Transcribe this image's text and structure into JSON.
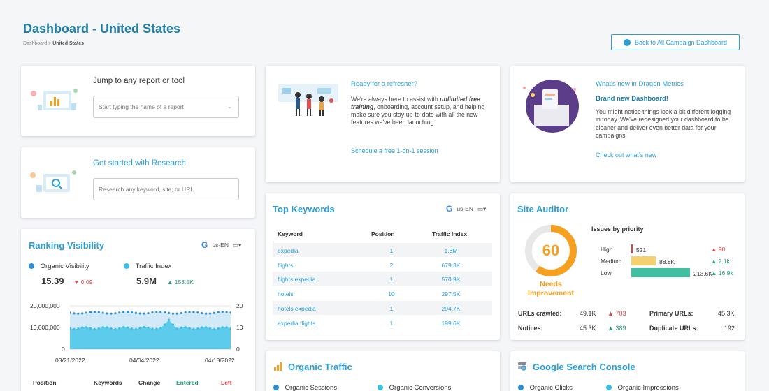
{
  "header": {
    "title": "Dashboard - United States",
    "breadcrumb_root": "Dashboard",
    "breadcrumb_sep": ">",
    "breadcrumb_current": "United States",
    "back_button": "Back to All Campaign Dashboard"
  },
  "jump": {
    "title": "Jump to any report or tool",
    "placeholder": "Start typing the name of a report"
  },
  "research": {
    "title": "Get started with Research",
    "placeholder": "Research any keyword, site, or URL"
  },
  "refresher": {
    "title": "Ready for a refresher?",
    "body_1": "We're always here to assist with ",
    "body_em": "unlimited free training",
    "body_2": ", onboarding, account setup, and helping make sure you stay up-to-date with all the new features we've been launching.",
    "link": "Schedule a free 1-on-1 session"
  },
  "whats_new": {
    "title": "What's new in Dragon Metrics",
    "subtitle": "Brand new Dashboard!",
    "body": "You might notice things look a bit different logging in today. We've redesigned your dashboard to be cleaner and deliver even better data for your campaigns.",
    "link": "Check out what's new"
  },
  "ranking": {
    "title": "Ranking Visibility",
    "locale": "us-EN",
    "legend_organic": "Organic Visibility",
    "legend_traffic": "Traffic Index",
    "organic_value": "15.39",
    "organic_change": "0.09",
    "traffic_value": "5.9M",
    "traffic_change": "153.5K",
    "y_left": [
      "20,000,000",
      "10,000,000",
      "0"
    ],
    "y_right": [
      "20",
      "10",
      "0"
    ],
    "x_labels": [
      "03/21/2022",
      "04/04/2022",
      "04/18/2022"
    ],
    "table_headers": [
      "Position",
      "Keywords",
      "Change",
      "Entered",
      "Left"
    ],
    "colors": {
      "organic": "#2a8fd8",
      "traffic": "#35c0e8"
    }
  },
  "top_keywords": {
    "title": "Top Keywords",
    "locale": "us-EN",
    "headers": [
      "Keyword",
      "Position",
      "Traffic Index"
    ],
    "rows": [
      {
        "keyword": "expedia",
        "position": "1",
        "traffic": "1.8M"
      },
      {
        "keyword": "flights",
        "position": "2",
        "traffic": "679.3K"
      },
      {
        "keyword": "flights expedia",
        "position": "1",
        "traffic": "570.9K"
      },
      {
        "keyword": "hotels",
        "position": "10",
        "traffic": "297.5K"
      },
      {
        "keyword": "hotels expedia",
        "position": "1",
        "traffic": "294.7K"
      },
      {
        "keyword": "expedia flights",
        "position": "1",
        "traffic": "199.6K"
      }
    ]
  },
  "site_auditor": {
    "title": "Site Auditor",
    "score": "60",
    "score_fraction": 0.6,
    "status": "Needs Improvement",
    "issues_title": "Issues by priority",
    "issues": [
      {
        "label": "High",
        "value": "521",
        "change": "98",
        "dir": "up",
        "fill": 0.005,
        "color": "#e04040"
      },
      {
        "label": "Medium",
        "value": "88.8K",
        "change": "2.1k",
        "dir": "up-green",
        "fill": 0.25,
        "color": "#f5d070"
      },
      {
        "label": "Low",
        "value": "213.6K",
        "change": "16.9k",
        "dir": "up-green",
        "fill": 0.6,
        "color": "#40c0a0"
      }
    ],
    "urls_crawled_label": "URLs crawled:",
    "urls_crawled": "49.1K",
    "urls_crawled_change": "703",
    "primary_label": "Primary URLs:",
    "primary": "45.3K",
    "notices_label": "Notices:",
    "notices": "45.3K",
    "notices_change": "389",
    "duplicate_label": "Duplicate URLs:",
    "duplicate": "192"
  },
  "organic_traffic": {
    "title": "Organic Traffic",
    "legend_1": "Organic Sessions",
    "legend_2": "Organic Conversions"
  },
  "gsc": {
    "title": "Google Search Console",
    "legend_1": "Organic Clicks",
    "legend_2": "Organic Impressions"
  }
}
